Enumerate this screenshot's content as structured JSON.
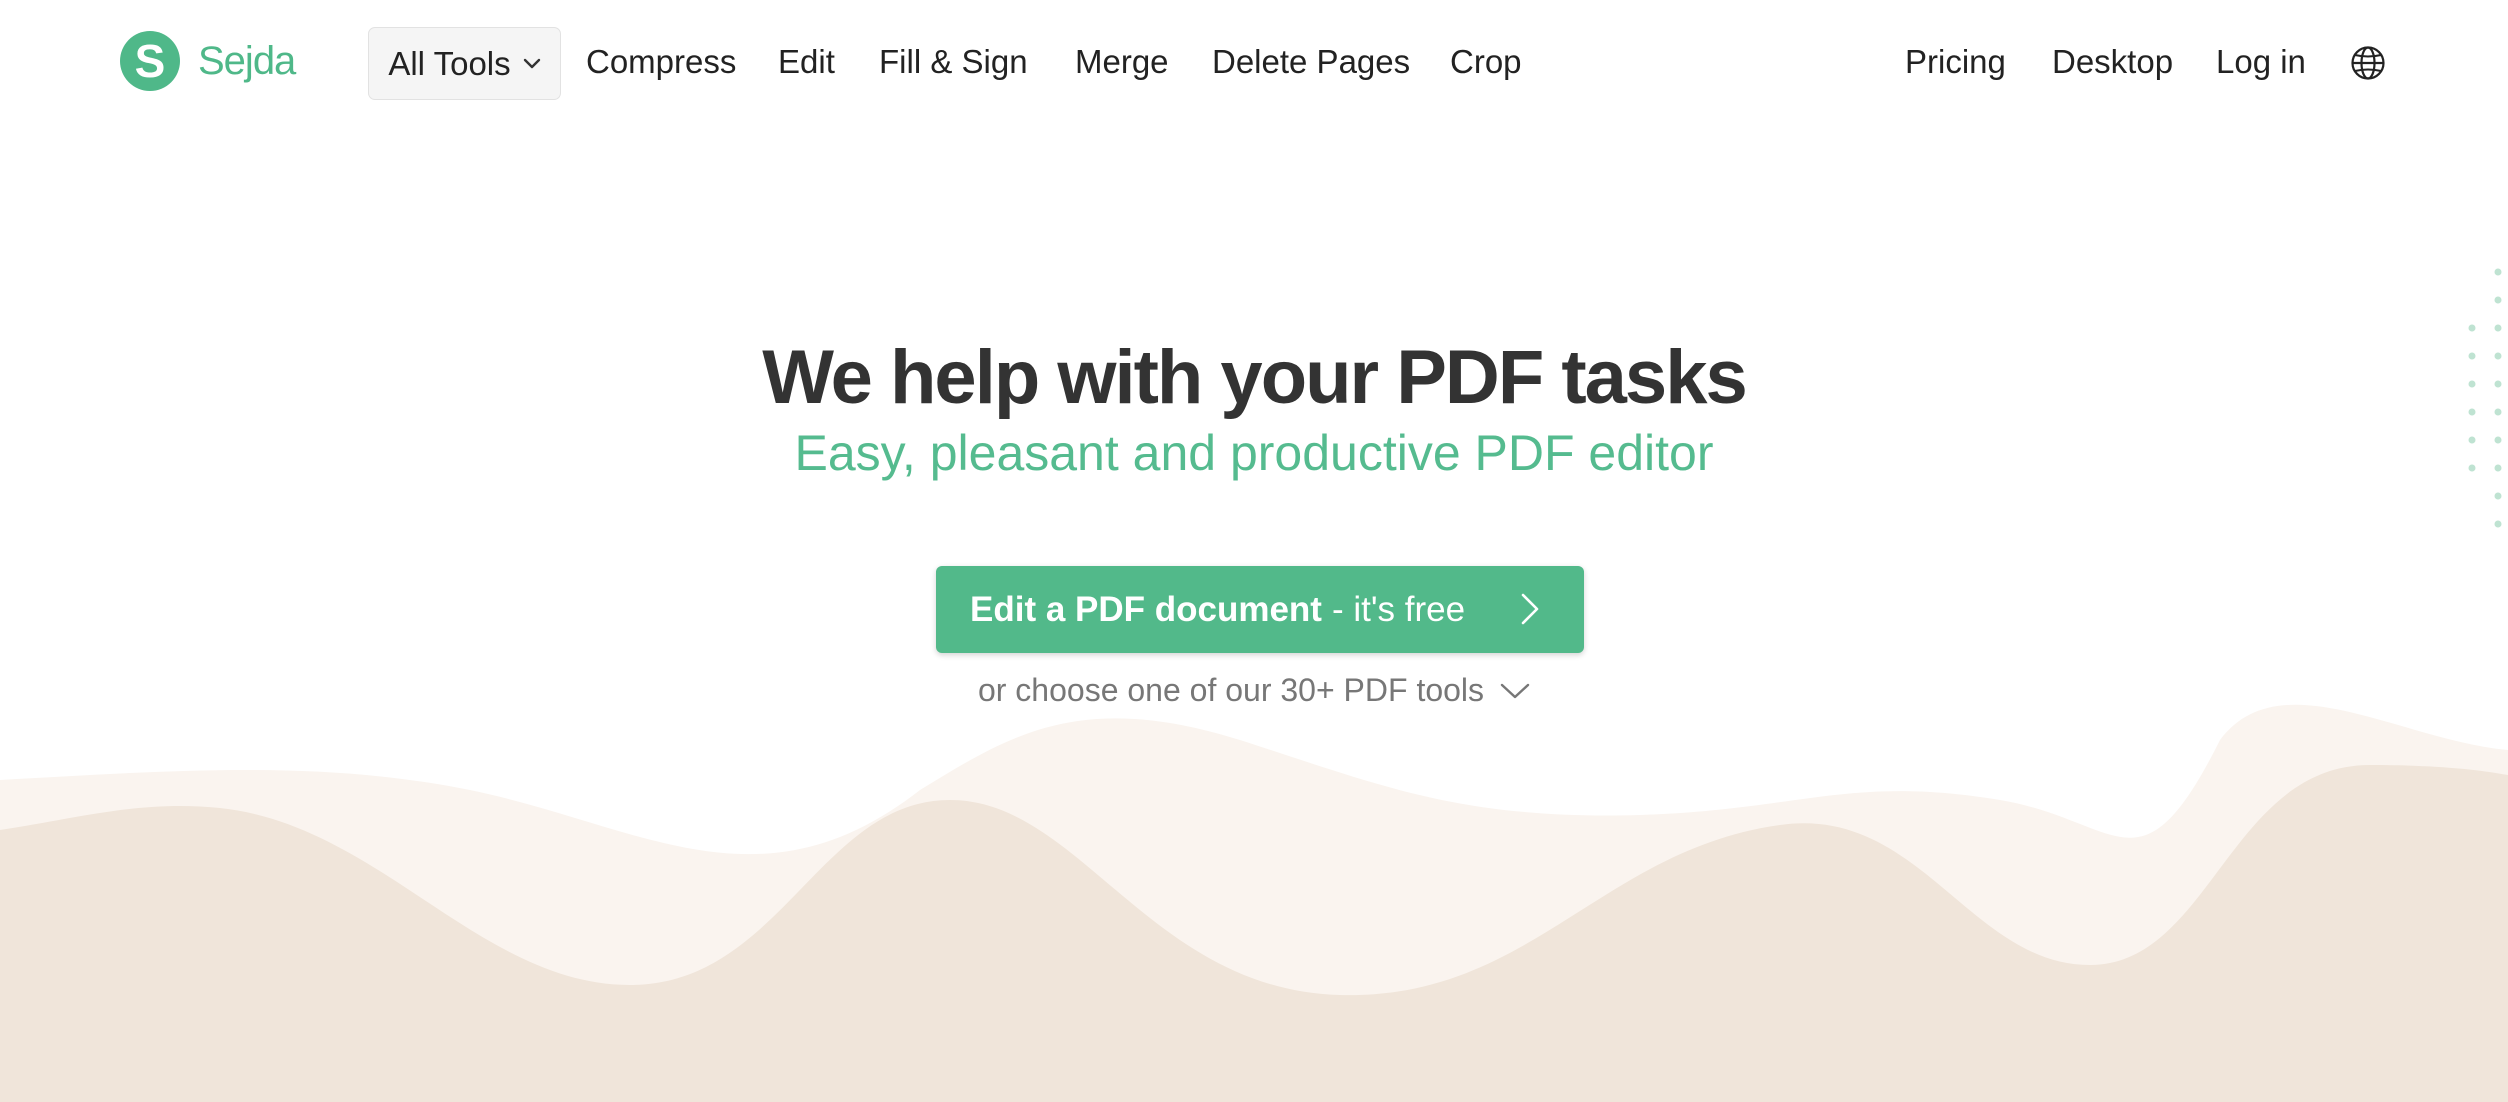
{
  "brand": {
    "logo_letter": "S",
    "name": "Sejda",
    "color": "#4fb889"
  },
  "nav": {
    "all_tools_label": "All Tools",
    "links": [
      "Compress",
      "Edit",
      "Fill & Sign",
      "Merge",
      "Delete Pages",
      "Crop"
    ],
    "right_links": [
      "Pricing",
      "Desktop",
      "Log in"
    ],
    "language_icon": "globe-icon"
  },
  "hero": {
    "title": "We help with your PDF tasks",
    "subtitle": "Easy, pleasant and productive PDF editor",
    "cta_strong": "Edit a PDF document",
    "cta_light": "- it's free",
    "choose_text": "or choose one of our 30+ PDF tools"
  },
  "colors": {
    "accent": "#52b98a",
    "title": "#333333",
    "wave_light": "#faf4ef",
    "wave_dark": "#f0e5da"
  }
}
